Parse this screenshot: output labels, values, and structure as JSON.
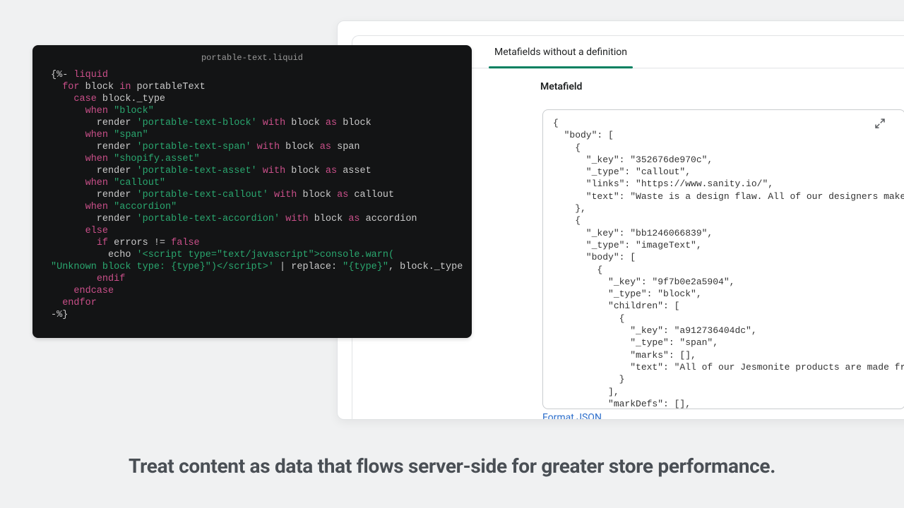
{
  "code": {
    "filename": "portable-text.liquid",
    "lines": [
      [
        [
          "",
          "{%- "
        ],
        [
          "key",
          "liquid"
        ]
      ],
      [
        [
          "",
          "  "
        ],
        [
          "key",
          "for"
        ],
        [
          "",
          " block "
        ],
        [
          "key",
          "in"
        ],
        [
          "",
          " portableText"
        ]
      ],
      [
        [
          "",
          "    "
        ],
        [
          "key",
          "case"
        ],
        [
          "",
          " block._type"
        ]
      ],
      [
        [
          "",
          "      "
        ],
        [
          "key",
          "when"
        ],
        [
          "",
          " "
        ],
        [
          "str",
          "\"block\""
        ]
      ],
      [
        [
          "",
          "        render "
        ],
        [
          "str",
          "'portable-text-block'"
        ],
        [
          "",
          " "
        ],
        [
          "key",
          "with"
        ],
        [
          "",
          " block "
        ],
        [
          "key",
          "as"
        ],
        [
          "",
          " block"
        ]
      ],
      [
        [
          "",
          "      "
        ],
        [
          "key",
          "when"
        ],
        [
          "",
          " "
        ],
        [
          "str",
          "\"span\""
        ]
      ],
      [
        [
          "",
          "        render "
        ],
        [
          "str",
          "'portable-text-span'"
        ],
        [
          "",
          " "
        ],
        [
          "key",
          "with"
        ],
        [
          "",
          " block "
        ],
        [
          "key",
          "as"
        ],
        [
          "",
          " span"
        ]
      ],
      [
        [
          "",
          "      "
        ],
        [
          "key",
          "when"
        ],
        [
          "",
          " "
        ],
        [
          "str",
          "\"shopify.asset\""
        ]
      ],
      [
        [
          "",
          "        render "
        ],
        [
          "str",
          "'portable-text-asset'"
        ],
        [
          "",
          " "
        ],
        [
          "key",
          "with"
        ],
        [
          "",
          " block "
        ],
        [
          "key",
          "as"
        ],
        [
          "",
          " asset"
        ]
      ],
      [
        [
          "",
          "      "
        ],
        [
          "key",
          "when"
        ],
        [
          "",
          " "
        ],
        [
          "str",
          "\"callout\""
        ]
      ],
      [
        [
          "",
          "        render "
        ],
        [
          "str",
          "'portable-text-callout'"
        ],
        [
          "",
          " "
        ],
        [
          "key",
          "with"
        ],
        [
          "",
          " block "
        ],
        [
          "key",
          "as"
        ],
        [
          "",
          " callout"
        ]
      ],
      [
        [
          "",
          "      "
        ],
        [
          "key",
          "when"
        ],
        [
          "",
          " "
        ],
        [
          "str",
          "\"accordion\""
        ]
      ],
      [
        [
          "",
          "        render "
        ],
        [
          "str",
          "'portable-text-accordion'"
        ],
        [
          "",
          " "
        ],
        [
          "key",
          "with"
        ],
        [
          "",
          " block "
        ],
        [
          "key",
          "as"
        ],
        [
          "",
          " accordion"
        ]
      ],
      [
        [
          "",
          "      "
        ],
        [
          "key",
          "else"
        ]
      ],
      [
        [
          "",
          "        "
        ],
        [
          "key",
          "if"
        ],
        [
          "",
          " errors != "
        ],
        [
          "key",
          "false"
        ]
      ],
      [
        [
          "",
          "          echo "
        ],
        [
          "str",
          "'<script type=\"text/javascript\">console.warn("
        ]
      ],
      [
        [
          "str",
          "\"Unknown block type: {type}\")</script>'"
        ],
        [
          "",
          " | replace: "
        ],
        [
          "str",
          "\"{type}\""
        ],
        [
          "",
          ", block._type"
        ]
      ],
      [
        [
          "",
          "        "
        ],
        [
          "key",
          "endif"
        ]
      ],
      [
        [
          "",
          "    "
        ],
        [
          "key",
          "endcase"
        ]
      ],
      [
        [
          "",
          "  "
        ],
        [
          "key",
          "endfor"
        ]
      ],
      [
        [
          "",
          "-%}"
        ]
      ]
    ]
  },
  "metafield": {
    "tab_label": "Metafields without a definition",
    "heading": "Metafield",
    "format_link": "Format JSON",
    "json_text": "{\n  \"body\": [\n    {\n      \"_key\": \"352676de970c\",\n      \"_type\": \"callout\",\n      \"links\": \"https://www.sanity.io/\",\n      \"text\": \"Waste is a design flaw. All of our designers make mo\n    },\n    {\n      \"_key\": \"bb1246066839\",\n      \"_type\": \"imageText\",\n      \"body\": [\n        {\n          \"_key\": \"9f7b0e2a5904\",\n          \"_type\": \"block\",\n          \"children\": [\n            {\n              \"_key\": \"a912736404dc\",\n              \"_type\": \"span\",\n              \"marks\": [],\n              \"text\": \"All of our Jesmonite products are made from\n            }\n          ],\n          \"markDefs\": [],\n          \"style\": \"normal\""
  },
  "tagline": "Treat content as data that flows server-side for greater store performance."
}
